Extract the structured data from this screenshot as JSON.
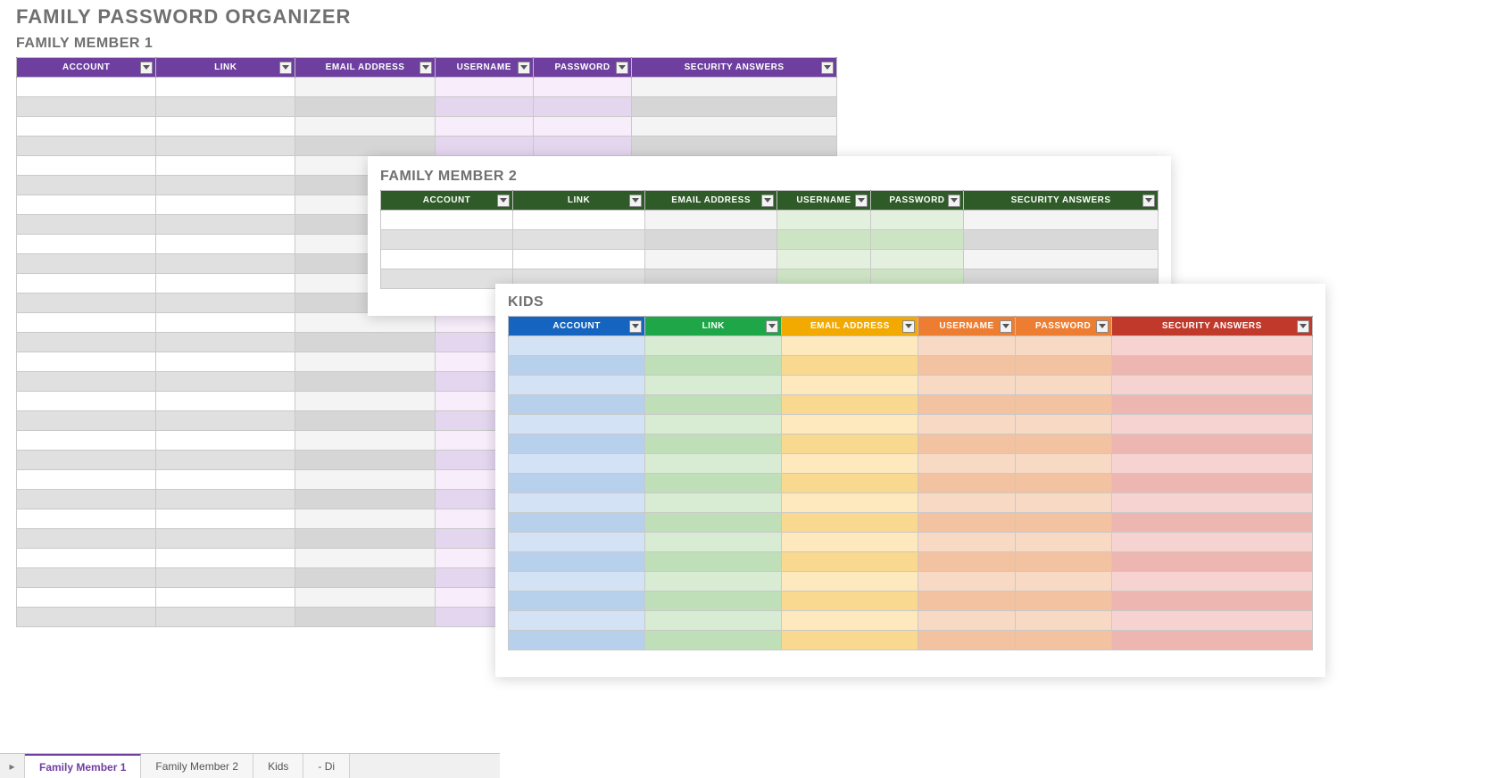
{
  "title": "FAMILY PASSWORD ORGANIZER",
  "columns": {
    "account": "ACCOUNT",
    "link": "LINK",
    "email": "EMAIL ADDRESS",
    "username": "USERNAME",
    "password": "PASSWORD",
    "security": "SECURITY ANSWERS"
  },
  "sheet1": {
    "label": "FAMILY MEMBER 1",
    "rows": 28
  },
  "sheet2": {
    "label": "FAMILY MEMBER 2",
    "rows": 4
  },
  "sheet3": {
    "label": "KIDS",
    "rows": 16
  },
  "tabs": {
    "t1": "Family Member 1",
    "t2": "Family Member 2",
    "t3": "Kids",
    "t4": "- Di"
  }
}
